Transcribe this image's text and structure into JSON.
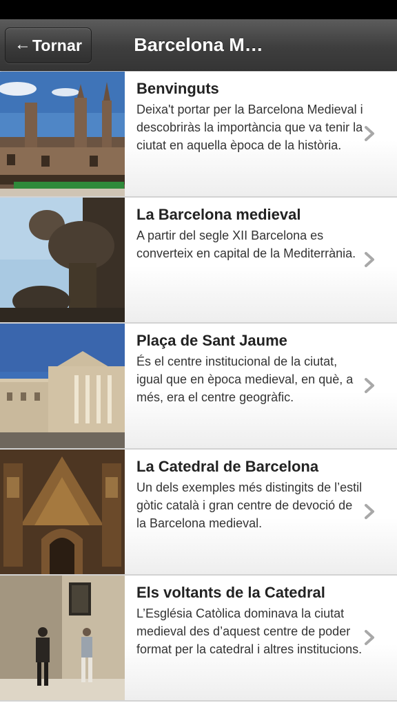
{
  "nav": {
    "back_label": "Tornar",
    "back_icon": "left-arrow-icon",
    "title": "Barcelona M…"
  },
  "items": [
    {
      "title": "Benvinguts",
      "description": "Deixa't portar per la Barcelona Medieval i descobriràs la importància que va tenir la ciutat en aquella època de la història.",
      "image": "medieval-buildings-photo"
    },
    {
      "title": "La Barcelona medieval",
      "description": "A partir del segle XII Barcelona es converteix en capital de la Mediterrània.",
      "image": "gargoyle-statue-photo"
    },
    {
      "title": "Plaça de Sant Jaume",
      "description": "És el centre institucional de la ciutat, igual que en època medieval, en què, a més, era el centre geogràfic.",
      "image": "square-building-photo"
    },
    {
      "title": "La Catedral de Barcelona",
      "description": "Un dels exemples més distingits de l’estil gòtic català i gran centre de devoció de la Barcelona medieval.",
      "image": "cathedral-facade-photo"
    },
    {
      "title": "Els voltants de la Catedral",
      "description": "L’Església Catòlica dominava la ciutat medieval des d’aquest centre de poder format per la catedral i altres institucions.",
      "image": "street-musicians-photo"
    }
  ],
  "colors": {
    "nav_bg": "#454545",
    "title_text": "#222222",
    "body_text": "#333333",
    "chevron": "#a8a8a8"
  }
}
